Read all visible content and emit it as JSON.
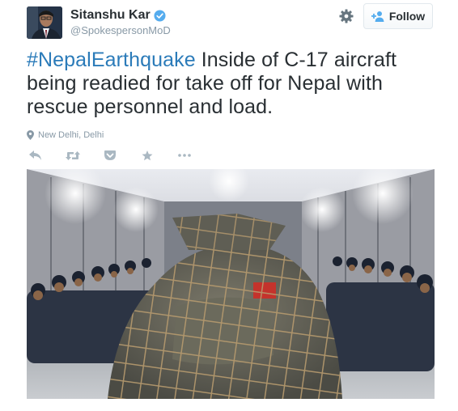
{
  "author": {
    "display_name": "Sitanshu Kar",
    "handle": "@SpokespersonMoD",
    "verified": true
  },
  "header": {
    "follow_label": "Follow",
    "settings_icon": "gear-icon",
    "follow_icon": "add-user-icon"
  },
  "tweet": {
    "hashtag": "#NepalEarthquake",
    "text": " Inside of C-17 aircraft being readied for take off for Nepal with rescue personnel and load.",
    "location": "New Delhi, Delhi"
  },
  "actions": [
    {
      "name": "reply-icon"
    },
    {
      "name": "retweet-icon"
    },
    {
      "name": "pocket-icon"
    },
    {
      "name": "favorite-icon"
    },
    {
      "name": "more-icon"
    }
  ],
  "colors": {
    "link": "#2b7bb9",
    "muted": "#8899a6",
    "verified": "#55acee",
    "icon": "#aab8c2"
  }
}
